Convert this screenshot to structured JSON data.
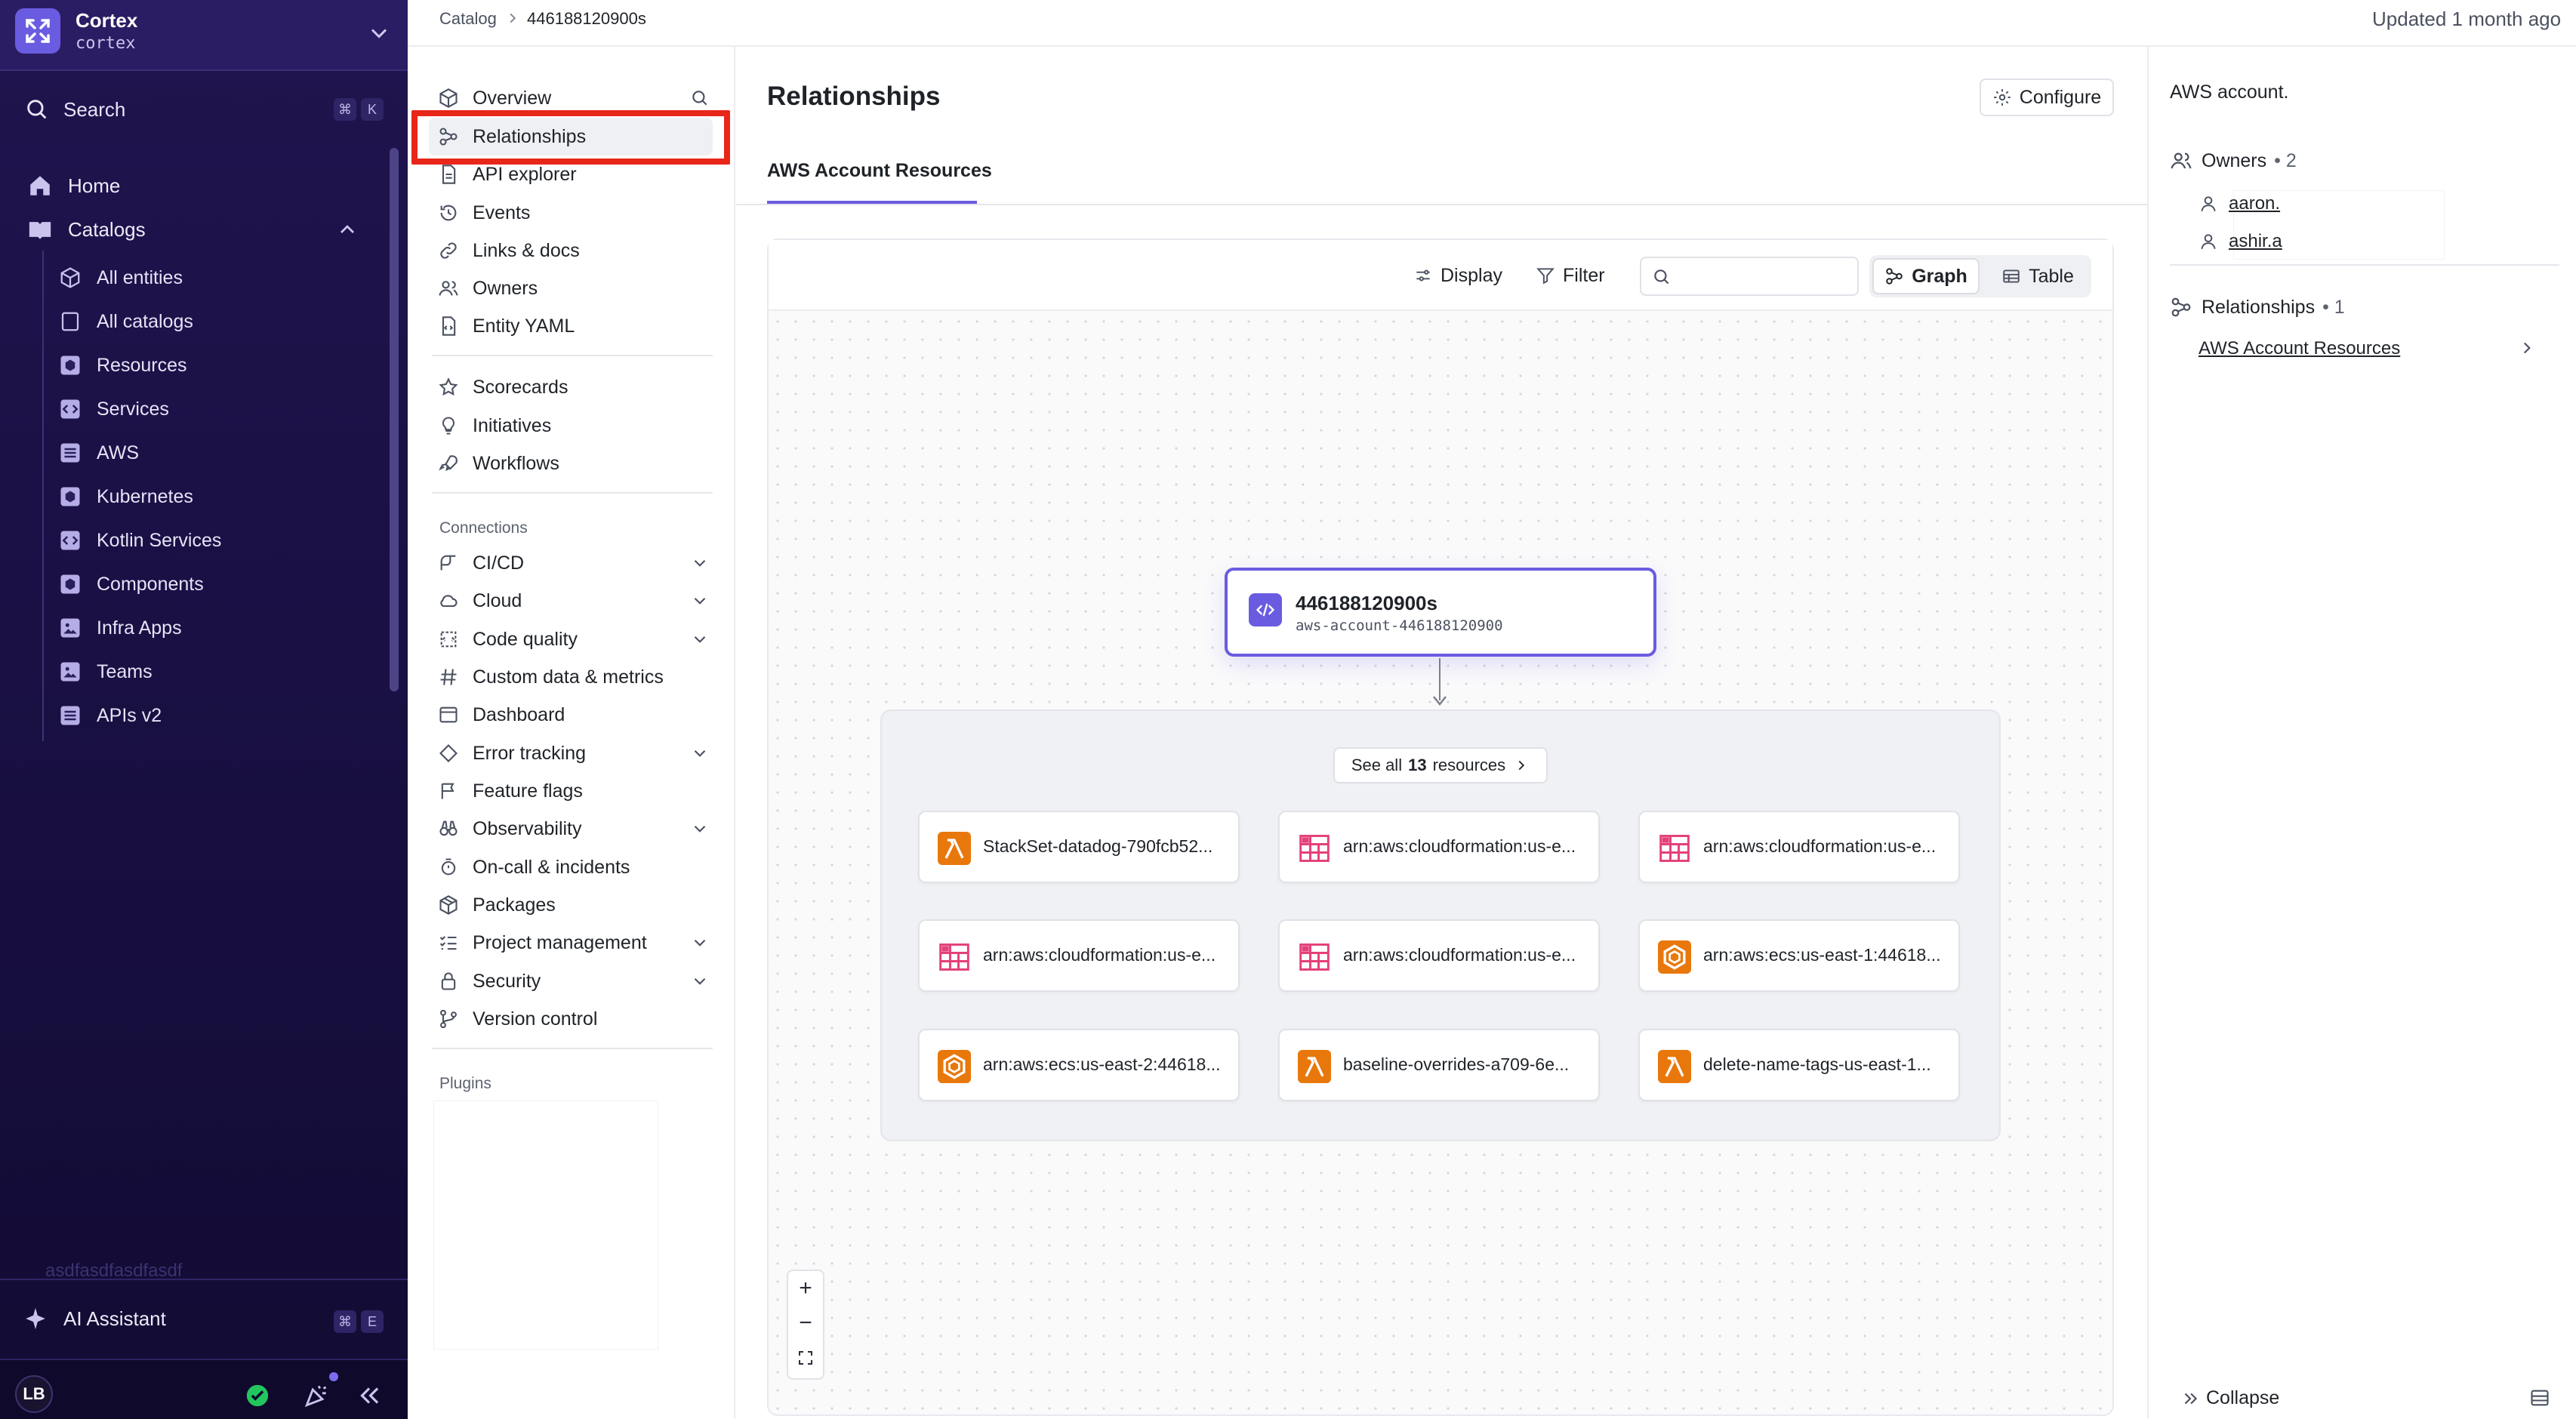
{
  "sidebar": {
    "org_name": "Cortex",
    "org_slug": "cortex",
    "search_label": "Search",
    "search_shortcut": [
      "⌘",
      "K"
    ],
    "home_label": "Home",
    "catalogs_label": "Catalogs",
    "catalog_items": [
      {
        "label": "All entities",
        "icon": "cube-icon"
      },
      {
        "label": "All catalogs",
        "icon": "square-icon"
      },
      {
        "label": "Resources",
        "icon": "cube-box-icon"
      },
      {
        "label": "Services",
        "icon": "code-box-icon"
      },
      {
        "label": "AWS",
        "icon": "list-box-icon"
      },
      {
        "label": "Kubernetes",
        "icon": "cube-box-icon"
      },
      {
        "label": "Kotlin Services",
        "icon": "code-box-icon"
      },
      {
        "label": "Components",
        "icon": "cube-box-icon"
      },
      {
        "label": "Infra Apps",
        "icon": "image-box-icon"
      },
      {
        "label": "Teams",
        "icon": "image-box-icon"
      },
      {
        "label": "APIs v2",
        "icon": "list-box-icon"
      }
    ],
    "faded_item": "asdfasdfasdfasdf",
    "ai_assistant_label": "AI Assistant",
    "ai_shortcut": [
      "⌘",
      "E"
    ],
    "user_initials": "LB"
  },
  "breadcrumb": {
    "parent": "Catalog",
    "current": "446188120900s"
  },
  "updated_text": "Updated 1 month ago",
  "entity_nav": {
    "group1": [
      {
        "label": "Overview",
        "icon": "cube-icon"
      },
      {
        "label": "Relationships",
        "icon": "relationships-icon"
      },
      {
        "label": "API explorer",
        "icon": "file-icon"
      },
      {
        "label": "Events",
        "icon": "history-icon"
      },
      {
        "label": "Links & docs",
        "icon": "link-icon"
      },
      {
        "label": "Owners",
        "icon": "users-icon"
      },
      {
        "label": "Entity YAML",
        "icon": "file-code-icon"
      }
    ],
    "group2": [
      {
        "label": "Scorecards",
        "icon": "star-icon"
      },
      {
        "label": "Initiatives",
        "icon": "lightbulb-icon"
      },
      {
        "label": "Workflows",
        "icon": "rocket-icon"
      }
    ],
    "connections_label": "Connections",
    "connections": [
      {
        "label": "CI/CD",
        "icon": "pipeline-icon",
        "expandable": true
      },
      {
        "label": "Cloud",
        "icon": "cloud-icon",
        "expandable": true
      },
      {
        "label": "Code quality",
        "icon": "code-quality-icon",
        "expandable": true
      },
      {
        "label": "Custom data & metrics",
        "icon": "hash-icon",
        "expandable": false
      },
      {
        "label": "Dashboard",
        "icon": "dashboard-icon",
        "expandable": false
      },
      {
        "label": "Error tracking",
        "icon": "diamond-icon",
        "expandable": true
      },
      {
        "label": "Feature flags",
        "icon": "flag-icon",
        "expandable": false
      },
      {
        "label": "Observability",
        "icon": "binoculars-icon",
        "expandable": true
      },
      {
        "label": "On-call & incidents",
        "icon": "oncall-icon",
        "expandable": false
      },
      {
        "label": "Packages",
        "icon": "package-icon",
        "expandable": false
      },
      {
        "label": "Project management",
        "icon": "tasks-icon",
        "expandable": true
      },
      {
        "label": "Security",
        "icon": "lock-icon",
        "expandable": true
      },
      {
        "label": "Version control",
        "icon": "git-branch-icon",
        "expandable": false
      }
    ],
    "plugins_label": "Plugins"
  },
  "main": {
    "title": "Relationships",
    "configure_label": "Configure",
    "tab_label": "AWS Account Resources",
    "toolbar": {
      "display_label": "Display",
      "filter_label": "Filter",
      "search_placeholder": "",
      "graph_label": "Graph",
      "table_label": "Table"
    },
    "root_node": {
      "title": "446188120900s",
      "subtitle": "aws-account-446188120900"
    },
    "see_all": {
      "prefix": "See all",
      "count": "13",
      "suffix": "resources"
    },
    "resource_cards": [
      {
        "label": "StackSet-datadog-790fcb52...",
        "kind": "lambda"
      },
      {
        "label": "arn:aws:cloudformation:us-e...",
        "kind": "cloudformation"
      },
      {
        "label": "arn:aws:cloudformation:us-e...",
        "kind": "cloudformation"
      },
      {
        "label": "arn:aws:cloudformation:us-e...",
        "kind": "cloudformation"
      },
      {
        "label": "arn:aws:cloudformation:us-e...",
        "kind": "cloudformation"
      },
      {
        "label": "arn:aws:ecs:us-east-1:44618...",
        "kind": "ecs"
      },
      {
        "label": "arn:aws:ecs:us-east-2:44618...",
        "kind": "ecs"
      },
      {
        "label": "baseline-overrides-a709-6e...",
        "kind": "lambda"
      },
      {
        "label": "delete-name-tags-us-east-1...",
        "kind": "lambda"
      }
    ],
    "zoom_controls": [
      "+",
      "−"
    ]
  },
  "right_panel": {
    "description": "AWS account.",
    "owners_label": "Owners",
    "owners_count": "• 2",
    "owners": [
      "aaron.",
      "ashir.a"
    ],
    "relationships_label": "Relationships",
    "relationships_count": "• 1",
    "relationship_link": "AWS Account Resources",
    "collapse_label": "Collapse"
  },
  "colors": {
    "accent": "#6a5ce0",
    "sidebar_bg": "#1a1044",
    "highlight_box": "#e8261a",
    "lambda": "#e8780c",
    "cloudformation": "#e4407a",
    "ecs": "#e8780c"
  }
}
